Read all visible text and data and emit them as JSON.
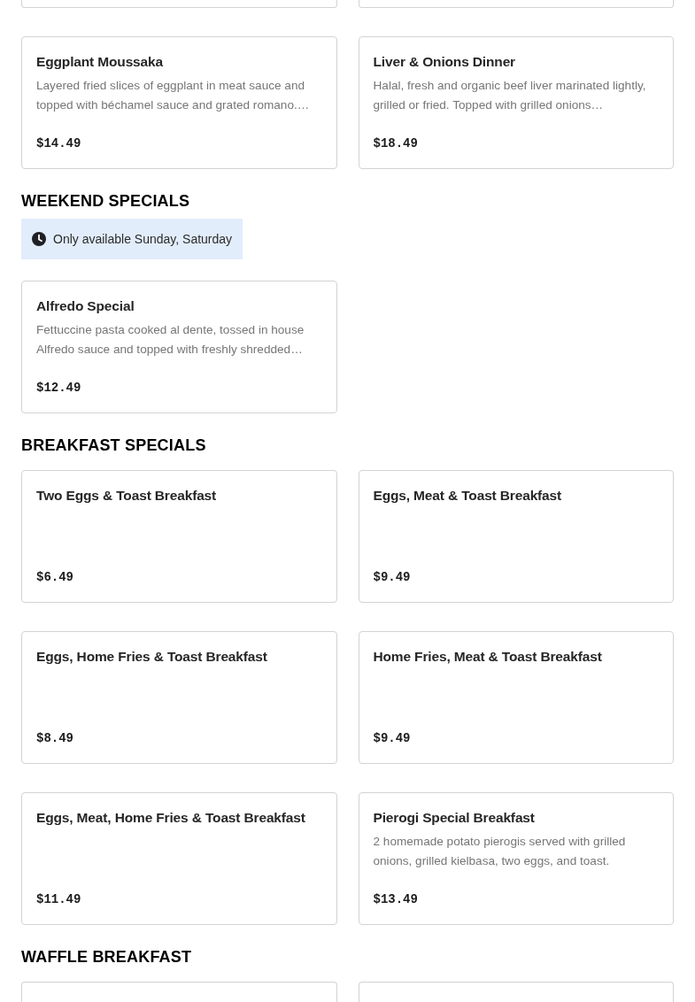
{
  "sections": [
    {
      "items": [
        {
          "kind": "cut-top"
        },
        {
          "kind": "cut-top"
        },
        {
          "kind": "full",
          "name": "Eggplant Moussaka",
          "description": "Layered fried slices of eggplant in meat sauce and topped with béchamel sauce and grated romano.…",
          "price": "$14.49"
        },
        {
          "kind": "full",
          "name": "Liver & Onions Dinner",
          "description": "Halal, fresh and organic beef liver marinated lightly, grilled or fried. Topped with grilled onions…",
          "price": "$18.49"
        }
      ]
    },
    {
      "title": "WEEKEND SPECIALS",
      "notice": "Only available Sunday, Saturday",
      "items": [
        {
          "kind": "full",
          "name": "Alfredo Special",
          "description": "Fettuccine pasta cooked al dente, tossed in house Alfredo sauce and topped with freshly shredded…",
          "price": "$12.49"
        }
      ]
    },
    {
      "title": "BREAKFAST SPECIALS",
      "items": [
        {
          "kind": "full",
          "name": "Two Eggs & Toast Breakfast",
          "price": "$6.49"
        },
        {
          "kind": "full",
          "name": "Eggs, Meat & Toast Breakfast",
          "price": "$9.49"
        },
        {
          "kind": "full",
          "name": "Eggs, Home Fries & Toast Breakfast",
          "price": "$8.49"
        },
        {
          "kind": "full",
          "name": "Home Fries, Meat & Toast Breakfast",
          "price": "$9.49"
        },
        {
          "kind": "full",
          "name": "Eggs, Meat, Home Fries & Toast Breakfast",
          "price": "$11.49"
        },
        {
          "kind": "full",
          "name": "Pierogi Special Breakfast",
          "description": "2 homemade potato pierogis served with grilled onions, grilled kielbasa, two eggs, and toast.",
          "price": "$13.49"
        }
      ]
    },
    {
      "title": "WAFFLE BREAKFAST",
      "items": [
        {
          "kind": "cut-bottom"
        },
        {
          "kind": "cut-bottom"
        }
      ]
    }
  ]
}
